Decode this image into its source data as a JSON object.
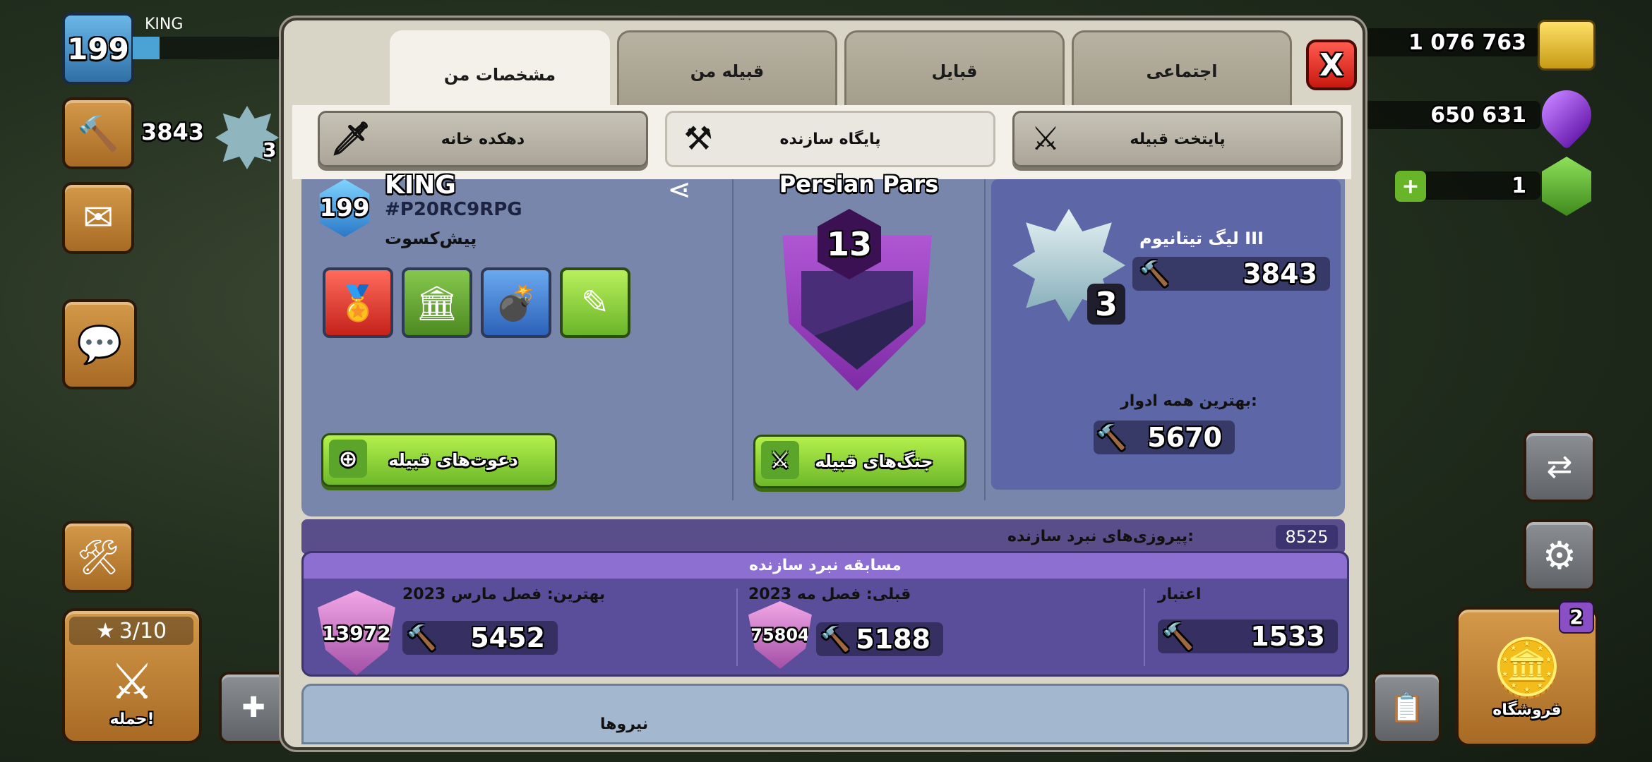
{
  "hud": {
    "player_level": "199",
    "player_name": "KING",
    "trophies": "3843",
    "gold": "1 076 763",
    "elixir": "650 631",
    "gems": "1",
    "attack_progress": "3/10",
    "attack_label": "حمله!",
    "shop_label": "فروشگاه",
    "shop_badge": "2",
    "league_side_badge": "3"
  },
  "tabs": [
    {
      "label": "مشخصات من"
    },
    {
      "label": "قبیله من"
    },
    {
      "label": "قبایل"
    },
    {
      "label": "اجتماعی"
    }
  ],
  "close_label": "X",
  "subtabs": [
    {
      "label": "دهکده خانه"
    },
    {
      "label": "پایگاه سازنده"
    },
    {
      "label": "پایتخت قبیله"
    }
  ],
  "profile": {
    "level": "199",
    "name": "KING",
    "tag": "#P20RC9RPG",
    "role": "پیش‌کسوت",
    "invite_button": "دعوت‌های قبیله",
    "clan_name": "Persian Pars",
    "clan_level": "13",
    "clan_wars_button": "جنگ‌های قبیله",
    "league_name": "لیگ تیتانیوم III",
    "league_rank": "3",
    "trophies": "3843",
    "best_label": "بهترین همه ادوار:",
    "best_trophies": "5670",
    "wins_label": "پیروزی‌های نبرد سازنده:",
    "wins_value": "8525"
  },
  "duel": {
    "title": "مسابقه نبرد سازنده",
    "best_label": "بهترین: فصل مارس 2023",
    "best_rank": "13972",
    "best_trophies": "5452",
    "prev_label": "قبلی: فصل مه 2023",
    "prev_rank": "75804",
    "prev_trophies": "5188",
    "rating_label": "اعتبار",
    "rating_value": "1533"
  },
  "bottom": {
    "label": "نیروها"
  },
  "colors": {
    "panel": "#d8d4c6",
    "profile_bg": "#7786aa",
    "league_card": "#5d66a6",
    "duel_bg": "#5a4d99",
    "green_button": "#8fd83a",
    "close_red": "#e2281a"
  }
}
